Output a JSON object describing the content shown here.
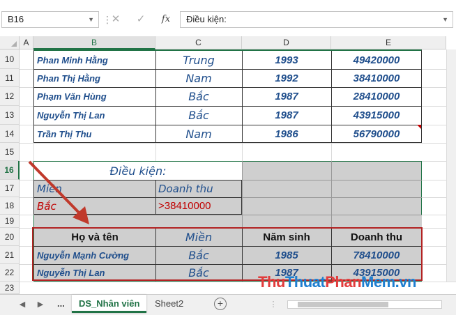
{
  "formula_bar": {
    "name_box": "B16",
    "cancel_icon": "close-icon",
    "enter_icon": "check-icon",
    "fx_label": "fx",
    "formula": "Điều kiện:"
  },
  "columns": [
    "A",
    "B",
    "C",
    "D",
    "E"
  ],
  "rows": [
    "10",
    "11",
    "12",
    "13",
    "14",
    "15",
    "16",
    "17",
    "18",
    "19",
    "20",
    "21",
    "22",
    "23"
  ],
  "employees": [
    {
      "name": "Phan  Minh Hằng",
      "region": "Trung",
      "year": "1993",
      "revenue": "49420000"
    },
    {
      "name": "Phan  Thị Hằng",
      "region": "Nam",
      "year": "1992",
      "revenue": "38410000"
    },
    {
      "name": "Phạm  Văn Hùng",
      "region": "Bắc",
      "year": "1987",
      "revenue": "28410000"
    },
    {
      "name": "Nguyễn  Thị Lan",
      "region": "Bắc",
      "year": "1987",
      "revenue": "43915000"
    },
    {
      "name": "Trần  Thị Thu",
      "region": "Nam",
      "year": "1986",
      "revenue": "56790000"
    }
  ],
  "criteria": {
    "title": "Điều kiện:",
    "h1": "Miền",
    "h2": "Doanh thu",
    "v1": "Bắc",
    "v2": ">38410000"
  },
  "result": {
    "headers": [
      "Họ và tên",
      "Miền",
      "Năm sinh",
      "Doanh thu"
    ],
    "rows": [
      {
        "name": "Nguyễn  Mạnh Cường",
        "region": "Bắc",
        "year": "1985",
        "revenue": "78410000"
      },
      {
        "name": "Nguyễn  Thị Lan",
        "region": "Bắc",
        "year": "1987",
        "revenue": "43915000"
      }
    ]
  },
  "tabs": {
    "more": "...",
    "active": "DS_Nhân viên",
    "other": "Sheet2",
    "add_icon": "plus-circle-icon"
  },
  "watermark": {
    "p1": "Thu",
    "p2": "Thuat",
    "p3": "Phan",
    "p4": "Mem.vn"
  },
  "colors": {
    "accent": "#217346",
    "cell_text": "#1f4e8c",
    "highlight_red": "#c00000",
    "result_border": "#b22222"
  }
}
